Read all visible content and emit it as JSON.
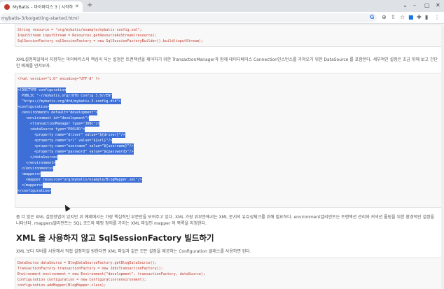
{
  "browser": {
    "tab_title": "MyBatis – 마이바티스 3 | 시작하기",
    "url": "mybatis-3/ko/getting-started.html"
  },
  "code1": [
    "String resource = \"org/mybatis/example/mybatis-config.xml\";",
    "InputStream inputStream = Resources.getResourceAsStream(resource);",
    "SqlSessionFactory sqlSessionFactory = new SqlSessionFactoryBuilder().build(inputStream);"
  ],
  "para1": "XML설정파일에서 지정하는 마이바티스의 핵심이 되는 설정은 트랜잭션을 제어하기 위한 TransactionManager과 함께 데이터베이스 Connection인스턴스를 가져오기 위한 DataSource 를 포함한다. 세부적인 설정은 조금 뒤에 보고 간단한 예제를 먼저보자.",
  "code2": [
    "<?xml version=\"1.0\" encoding=\"UTF-8\" ?>",
    "<!DOCTYPE configuration",
    "  PUBLIC \"-//mybatis.org//DTD Config 3.0//EN\"",
    "  \"https://mybatis.org/dtd/mybatis-3-config.dtd\">",
    "<configuration>",
    "  <environments default=\"development\">",
    "    <environment id=\"development\">",
    "      <transactionManager type=\"JDBC\"/>",
    "      <dataSource type=\"POOLED\">",
    "        <property name=\"driver\" value=\"${driver}\"/>",
    "        <property name=\"url\" value=\"${url}\"/>",
    "        <property name=\"username\" value=\"${username}\"/>",
    "        <property name=\"password\" value=\"${password}\"/>",
    "      </dataSource>",
    "    </environment>",
    "  </environments>",
    "  <mappers>",
    "    <mapper resource=\"org/mybatis/example/BlogMapper.xml\"/>",
    "  </mappers>",
    "</configuration>"
  ],
  "para2": "좀 더 많은 XML 설정방법이 있지만 위 예제에서는 가장 핵심적인 부분만을 보여주고 있다. XML 가장 위부분에서는 XML 문서의 유효성체크를 위해 필요하다. environment엘리먼트는 트랜잭션 관리와 커넥션 풀링을 위한 환경적인 설정을 나타낸다. mappers엘리먼트는 SQL 코드와 매핑 정의를 가지는 XML 파일인 mapper 의 목록을 지정한다.",
  "heading": "XML 을 사용하지 않고 SqlSessionFactory 빌드하기",
  "para3": "XML 보다 자바를 사용해서 직접 설정하길 원한다면 XML 파일과 같은 모든 설정을 제공하는 Configuration 클래스를 사용하면 된다.",
  "code3": [
    "DataSource dataSource = BlogDataSourceFactory.getBlogDataSource();",
    "TransactionFactory transactionFactory = new JdbcTransactionFactory();",
    "Environment environment = new Environment(\"development\", transactionFactory, dataSource);",
    "Configuration configuration = new Configuration(environment);",
    "configuration.addMapper(BlogMapper.class);"
  ],
  "colors": {
    "selection": "#3d6fd6",
    "code_text": "#c0392b"
  }
}
